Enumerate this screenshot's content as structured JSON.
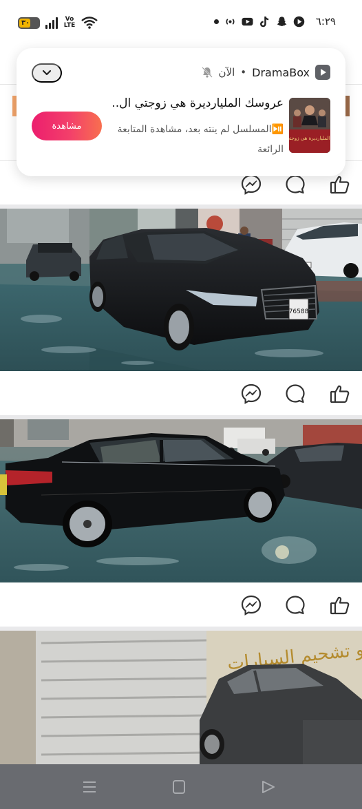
{
  "status_bar": {
    "time": "٦:٢٩",
    "battery_level": "٣٠",
    "network_label": "Vo LTE",
    "icons": [
      "dot-icon",
      "broadcast-icon",
      "youtube-icon",
      "tiktok-icon",
      "snapchat-icon",
      "dramabox-icon",
      "wifi-icon",
      "signal-icon",
      "battery-icon"
    ]
  },
  "notification": {
    "app_name": "DramaBox",
    "time": "الآن",
    "title": "عروسك المليارديرة هي زوجتي ال..",
    "body": "⏯️المسلسل لم ينته بعد، مشاهدة المتابعة الرائعة",
    "action_label": "مشاهدة",
    "thumbnail_caption": "عروسك المليارديرة هي زوجتي الخفية",
    "colors": {
      "accent_start": "#ec1e6e",
      "accent_end": "#f86f4f"
    }
  },
  "feed": {
    "posts": [
      {
        "photo": "black-sedan-front-view",
        "actions": [
          "messenger-icon",
          "comment-icon",
          "like-icon"
        ]
      },
      {
        "photo": "black-sedan-side-view",
        "actions": [
          "messenger-icon",
          "comment-icon",
          "like-icon"
        ]
      },
      {
        "photo": "car-wash-sign-wall"
      }
    ],
    "sign_text": "و تشحيم السيارات",
    "plate_text": "76588"
  },
  "nav_bar": {
    "icons": [
      "menu-icon",
      "home-square-icon",
      "back-triangle-icon"
    ]
  }
}
